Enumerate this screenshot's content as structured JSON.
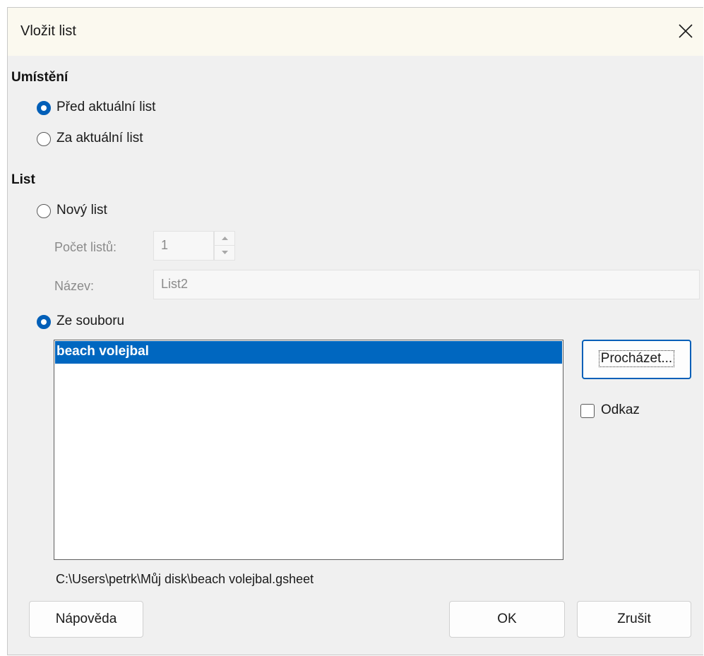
{
  "window": {
    "title": "Vložit list",
    "close_icon": "close-icon"
  },
  "placement": {
    "heading": "Umístění",
    "options": [
      {
        "label": "Před aktuální list",
        "checked": true
      },
      {
        "label": "Za aktuální list",
        "checked": false
      }
    ]
  },
  "sheet": {
    "heading": "List",
    "new_sheet": {
      "label": "Nový list",
      "checked": false,
      "count_label": "Počet listů:",
      "count_value": "1",
      "name_label": "Název:",
      "name_value": "List2"
    },
    "from_file": {
      "label": "Ze souboru",
      "checked": true,
      "items": [
        "beach volejbal"
      ],
      "selected_index": 0,
      "browse_label": "Procházet...",
      "link_label": "Odkaz",
      "link_checked": false,
      "path": "C:\\Users\\petrk\\Můj disk\\beach volejbal.gsheet"
    }
  },
  "footer": {
    "help_label": "Nápověda",
    "ok_label": "OK",
    "cancel_label": "Zrušit"
  },
  "colors": {
    "accent": "#005fb8",
    "selection": "#0067c0",
    "dialog_bg": "#f0f0f0",
    "titlebar_bg": "#fbf9ef"
  }
}
